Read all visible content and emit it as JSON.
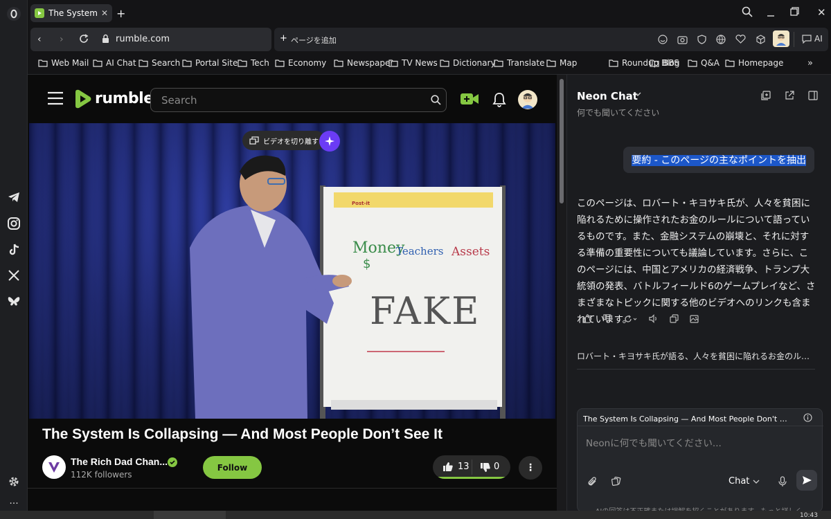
{
  "browser": {
    "tab_title": "The System Is",
    "url": "rumble.com",
    "add_page_label": "ページを追加",
    "ai_label": "AI",
    "time": "10:43"
  },
  "bookmarks": [
    {
      "label": "Web Mail",
      "icon": "folder-icon"
    },
    {
      "label": "AI Chat",
      "icon": "folder-icon"
    },
    {
      "label": "Search",
      "icon": "folder-icon"
    },
    {
      "label": "Portal Site",
      "icon": "folder-icon"
    },
    {
      "label": "Tech",
      "icon": "folder-icon"
    },
    {
      "label": "Economy",
      "icon": "folder-icon"
    },
    {
      "label": "Newspaper",
      "icon": "folder-icon"
    },
    {
      "label": "TV News",
      "icon": "folder-icon"
    },
    {
      "label": "Dictionary",
      "icon": "folder-icon"
    },
    {
      "label": "Translate",
      "icon": "folder-icon"
    },
    {
      "label": "Map",
      "icon": "folder-icon"
    },
    {
      "label": "Roundup Blog",
      "icon": "folder-icon"
    },
    {
      "label": "BBS",
      "icon": "folder-icon"
    },
    {
      "label": "Q&A",
      "icon": "folder-icon"
    },
    {
      "label": "Homepage",
      "icon": "folder-icon"
    }
  ],
  "rumble": {
    "logo_text": "rumble",
    "search_placeholder": "Search",
    "detach_label": "ビデオを切り離す",
    "video_title": "The System Is Collapsing — And Most People Don’t See It",
    "channel_name": "The Rich Dad Chan...",
    "followers": "112K followers",
    "follow_label": "Follow",
    "likes": "13",
    "dislikes": "0"
  },
  "whiteboard": {
    "pad_brand": "Post-it",
    "word1": "Money",
    "dollar": "$",
    "word2": "Teachers",
    "word3": "Assets",
    "big_word": "FAKE"
  },
  "chat": {
    "title": "Neon Chat",
    "subtitle": "何でも聞いてください",
    "user_message": "要約 - このページの主なポイントを抽出",
    "ai_response": "このページは、ロバート・キヨサキ氏が、人々を貧困に陥れるために操作されたお金のルールについて語っているものです。また、金融システムの崩壊と、それに対する準備の重要性についても議論しています。さらに、このページには、中国とアメリカの経済戦争、トランプ大統領の発表、バトルフィールド6のゲームプレイなど、さまざまなトピックに関する他のビデオへのリンクも含まれています。",
    "history_item": "ロバート・キヨサキ氏が語る、人々を貧困に陥れるお金のルール...",
    "context_tab": "The System Is Collapsing — And Most People Don't See It コ...",
    "input_placeholder": "Neonに何でも聞いてください...",
    "mode_label": "Chat",
    "disclaimer": "AIの回答は不正確または誤解を招くことがあります。もっと詳しく"
  },
  "colors": {
    "rumble_green": "#85c742",
    "accent_purple": "#6b3cf5",
    "selection_blue": "#1c57c9",
    "panel_bg": "#1b1c1f"
  }
}
